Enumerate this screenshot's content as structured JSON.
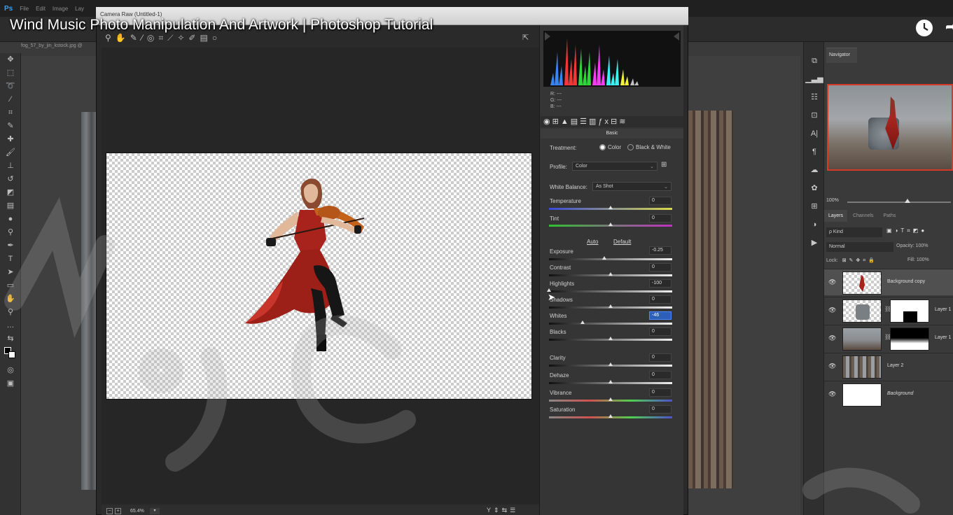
{
  "video": {
    "title": "Wind Music Photo Manipulation And Artwork | Photoshop Tutorial",
    "clock_icon": "clock-icon",
    "share_icon": "share-icon"
  },
  "photoshop": {
    "logo": "Ps",
    "menu": [
      "File",
      "Edit",
      "Image",
      "Lay"
    ],
    "doc_tab": "fog_57_by_jin_kstock.jpg @",
    "tools": [
      "move-icon",
      "marquee-icon",
      "lasso-icon",
      "magic-wand-icon",
      "crop-icon",
      "eyedropper-icon",
      "healing-icon",
      "brush-icon",
      "stamp-icon",
      "history-brush-icon",
      "eraser-icon",
      "gradient-icon",
      "blur-icon",
      "dodge-icon",
      "pen-icon",
      "type-icon",
      "path-select-icon",
      "shape-icon",
      "hand-icon",
      "zoom-icon",
      "more-icon",
      "swap-icon"
    ],
    "panel_strip_icons": [
      "history-icon",
      "histogram-icon",
      "properties-icon",
      "info-icon",
      "character-icon",
      "paragraph-icon",
      "libraries-icon",
      "adjust-icon",
      "swatches-icon",
      "styles-icon",
      "actions-icon"
    ]
  },
  "camera_raw": {
    "title": "Camera Raw (Untitled-1)",
    "zoom_minus": "−",
    "zoom_plus": "+",
    "zoom": "65.4%",
    "rgb": {
      "r": "R:  ---",
      "g": "G:  ---",
      "b": "B:  ---"
    },
    "panel_header": "Basic",
    "treatment_label": "Treatment:",
    "treatment_color": "Color",
    "treatment_bw": "Black & White",
    "profile_label": "Profile:",
    "profile_value": "Color",
    "wb_label": "White Balance:",
    "wb_value": "As Shot",
    "auto_label": "Auto",
    "default_label": "Default",
    "sliders": [
      {
        "label": "Temperature",
        "value": "0",
        "pos": 0.5
      },
      {
        "label": "Tint",
        "value": "0",
        "pos": 0.5
      },
      {
        "label": "Exposure",
        "value": "-0.25",
        "pos": 0.45
      },
      {
        "label": "Contrast",
        "value": "0",
        "pos": 0.5
      },
      {
        "label": "Highlights",
        "value": "-100",
        "pos": 0.0
      },
      {
        "label": "Shadows",
        "value": "0",
        "pos": 0.5
      },
      {
        "label": "Whites",
        "value": "-46",
        "pos": 0.27
      },
      {
        "label": "Blacks",
        "value": "0",
        "pos": 0.5
      },
      {
        "label": "Clarity",
        "value": "0",
        "pos": 0.5
      },
      {
        "label": "Dehaze",
        "value": "0",
        "pos": 0.5
      },
      {
        "label": "Vibrance",
        "value": "0",
        "pos": 0.5
      },
      {
        "label": "Saturation",
        "value": "0",
        "pos": 0.5
      }
    ]
  },
  "navigator": {
    "tab": "Navigator",
    "zoom": "100%",
    "zoom_pos": 0.58
  },
  "layers": {
    "tabs": [
      "Layers",
      "Channels",
      "Paths"
    ],
    "kind": "ρ Kind",
    "blend": "Normal",
    "opacity": "Opacity:  100%",
    "lock": "Lock:",
    "fill": "Fill:  100%",
    "items": [
      {
        "name": "Background copy",
        "selected": true
      },
      {
        "name": "Layer 1",
        "selected": false
      },
      {
        "name": "Layer 1",
        "selected": false
      },
      {
        "name": "Layer 2",
        "selected": false
      },
      {
        "name": "Background",
        "selected": false
      }
    ]
  },
  "colors": {
    "accent_blue": "#2b5fb8",
    "nav_border": "#d43a2a",
    "dress": "#a8231b"
  }
}
